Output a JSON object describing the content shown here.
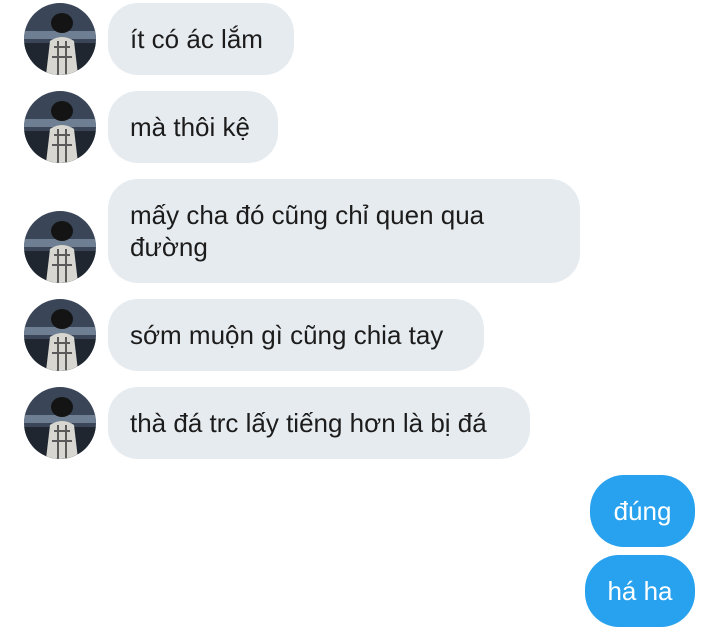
{
  "conversation": {
    "incoming": [
      {
        "text": "ít có ác lắm"
      },
      {
        "text": "mà thôi kệ"
      },
      {
        "text": "mấy cha đó cũng chỉ quen qua đường"
      },
      {
        "text": "sớm muộn gì cũng chia tay"
      },
      {
        "text": "thà đá trc lấy tiếng hơn là bị đá"
      }
    ],
    "outgoing": [
      {
        "text": "đúng"
      },
      {
        "text": "há ha"
      }
    ],
    "colors": {
      "incoming_bubble": "#e6ebef",
      "outgoing_bubble": "#28a2ef",
      "incoming_text": "#1c1c1c",
      "outgoing_text": "#ffffff"
    },
    "avatar_icon": "user-avatar-photo"
  }
}
